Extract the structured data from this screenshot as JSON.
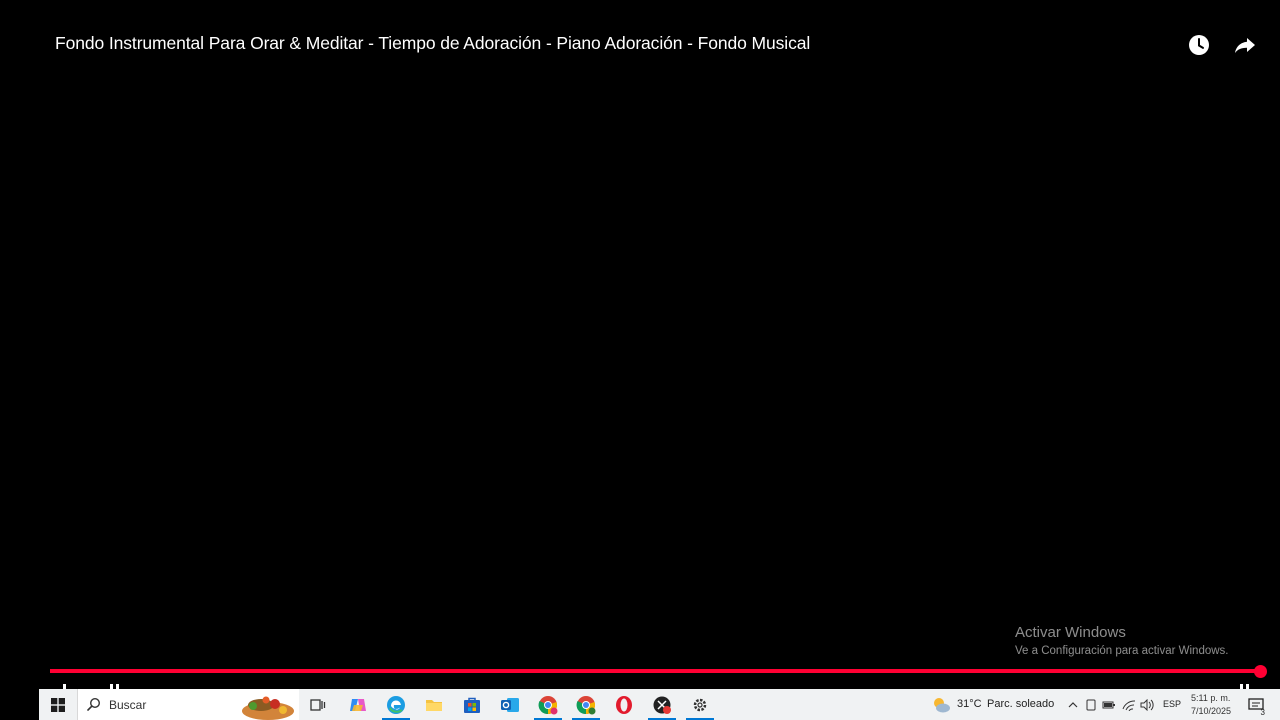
{
  "video": {
    "title": "Fondo Instrumental Para Orar & Meditar - Tiempo de Adoración - Piano Adoración - Fondo Musical",
    "top_icons": [
      "clock-icon",
      "share-icon"
    ],
    "progress_fraction": 0.995,
    "progress_color": "#ff0033"
  },
  "watermark": {
    "title": "Activar Windows",
    "subtitle": "Ve a Configuración para activar Windows."
  },
  "taskbar": {
    "search_placeholder": "Buscar",
    "apps": [
      "task-view-icon",
      "copilot-icon",
      "edge-icon",
      "file-explorer-icon",
      "store-icon",
      "outlook-icon",
      "chrome-profile-1-icon",
      "chrome-profile-2-icon",
      "opera-icon",
      "app-icon",
      "settings-icon"
    ],
    "weather": {
      "temp": "31°C",
      "condition": "Parc. soleado"
    },
    "language": "ESP",
    "clock": {
      "time": "5:11 p. m.",
      "date": "7/10/2025"
    },
    "notifications_count": "3"
  }
}
